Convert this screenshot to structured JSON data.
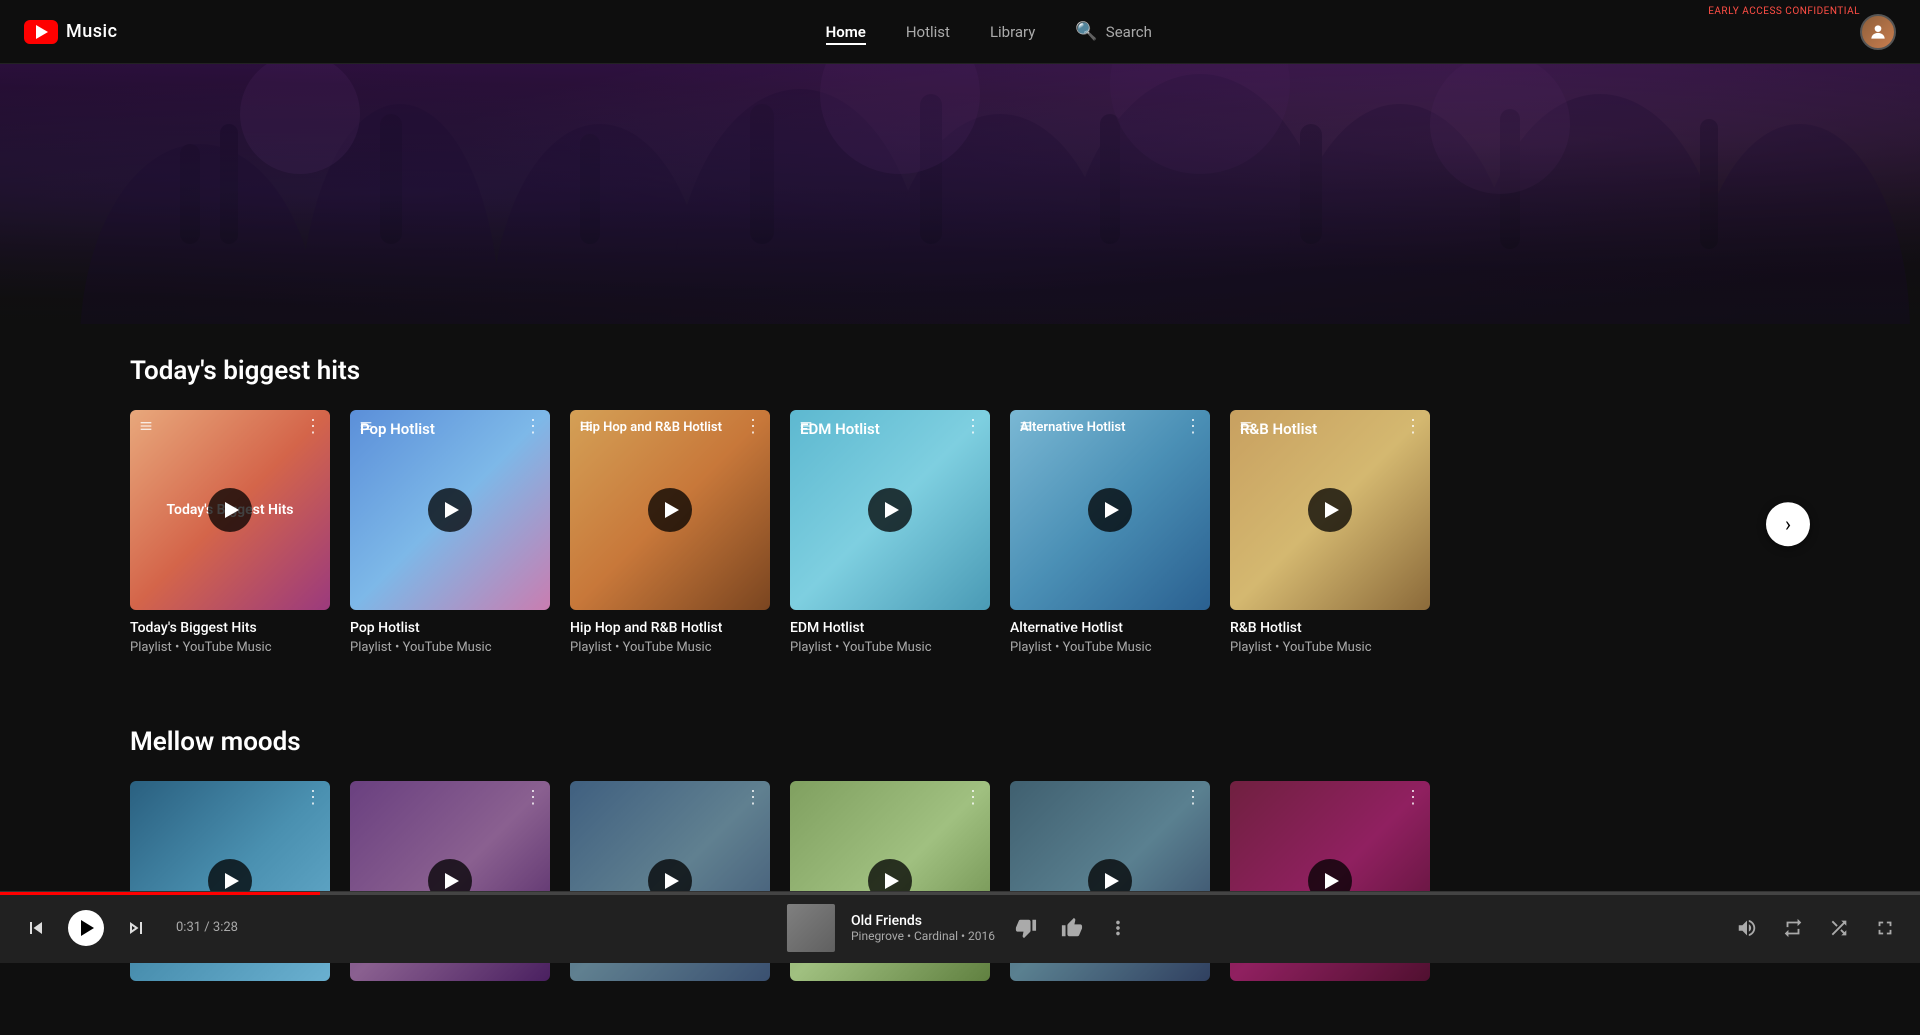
{
  "app": {
    "name": "Music",
    "early_access": "EARLY ACCESS CONFIDENTIAL"
  },
  "nav": {
    "links": [
      {
        "id": "home",
        "label": "Home",
        "active": true
      },
      {
        "id": "hotlist",
        "label": "Hotlist",
        "active": false
      },
      {
        "id": "library",
        "label": "Library",
        "active": false
      }
    ],
    "search_label": "Search",
    "search_icon": "🔍"
  },
  "sections": [
    {
      "id": "biggest-hits",
      "title": "Today's biggest hits",
      "cards": [
        {
          "id": "c1",
          "title": "Today's Biggest Hits",
          "subtitle": "Playlist • YouTube Music",
          "thumb_text": "Today's Biggest Hits",
          "bg_class": "card-bg-1",
          "show_text": true
        },
        {
          "id": "c2",
          "title": "Pop Hotlist",
          "subtitle": "Playlist • YouTube Music",
          "thumb_text": "Pop Hotlist",
          "bg_class": "card-bg-2",
          "show_text": true
        },
        {
          "id": "c3",
          "title": "Hip Hop and R&B Hotlist",
          "subtitle": "Playlist • YouTube Music",
          "thumb_text": "Hip Hop and R&B Hotlist",
          "bg_class": "card-bg-3",
          "show_text": true
        },
        {
          "id": "c4",
          "title": "EDM Hotlist",
          "subtitle": "Playlist • YouTube Music",
          "thumb_text": "EDM Hotlist",
          "bg_class": "card-bg-4",
          "show_text": true
        },
        {
          "id": "c5",
          "title": "Alternative Hotlist",
          "subtitle": "Playlist • YouTube Music",
          "thumb_text": "Alternative Hotlist",
          "bg_class": "card-bg-5",
          "show_text": true
        },
        {
          "id": "c6",
          "title": "R&B Hotlist",
          "subtitle": "Playlist • YouTube Music",
          "thumb_text": "R&B Hotlist",
          "bg_class": "card-bg-6",
          "show_text": true
        }
      ]
    },
    {
      "id": "mellow-moods",
      "title": "Mellow moods",
      "cards": [
        {
          "id": "m1",
          "title": "",
          "subtitle": "",
          "thumb_text": "",
          "bg_class": "card-bg-7",
          "show_text": false
        },
        {
          "id": "m2",
          "title": "",
          "subtitle": "",
          "thumb_text": "",
          "bg_class": "card-bg-8",
          "show_text": false
        },
        {
          "id": "m3",
          "title": "",
          "subtitle": "",
          "thumb_text": "",
          "bg_class": "card-bg-9",
          "show_text": false
        },
        {
          "id": "m4",
          "title": "",
          "subtitle": "",
          "thumb_text": "",
          "bg_class": "card-bg-10",
          "show_text": false
        },
        {
          "id": "m5",
          "title": "",
          "subtitle": "",
          "thumb_text": "",
          "bg_class": "card-bg-11",
          "show_text": false
        },
        {
          "id": "m6",
          "title": "",
          "subtitle": "",
          "thumb_text": "",
          "bg_class": "card-bg-12",
          "show_text": false
        }
      ]
    }
  ],
  "player": {
    "current_time": "0:31",
    "total_time": "3:28",
    "progress_pct": 16.67,
    "song_title": "Old Friends",
    "song_artist": "Pinegrove",
    "song_album": "Cardinal",
    "song_year": "2016",
    "song_meta": "Pinegrove • Cardinal • 2016",
    "controls": {
      "skip_prev": "⏮",
      "play": "▶",
      "skip_next": "⏭",
      "dislike": "👎",
      "like": "👍",
      "more": "⋮",
      "volume": "🔊",
      "repeat": "🔁",
      "shuffle": "🔀",
      "expand": "⌃"
    }
  }
}
